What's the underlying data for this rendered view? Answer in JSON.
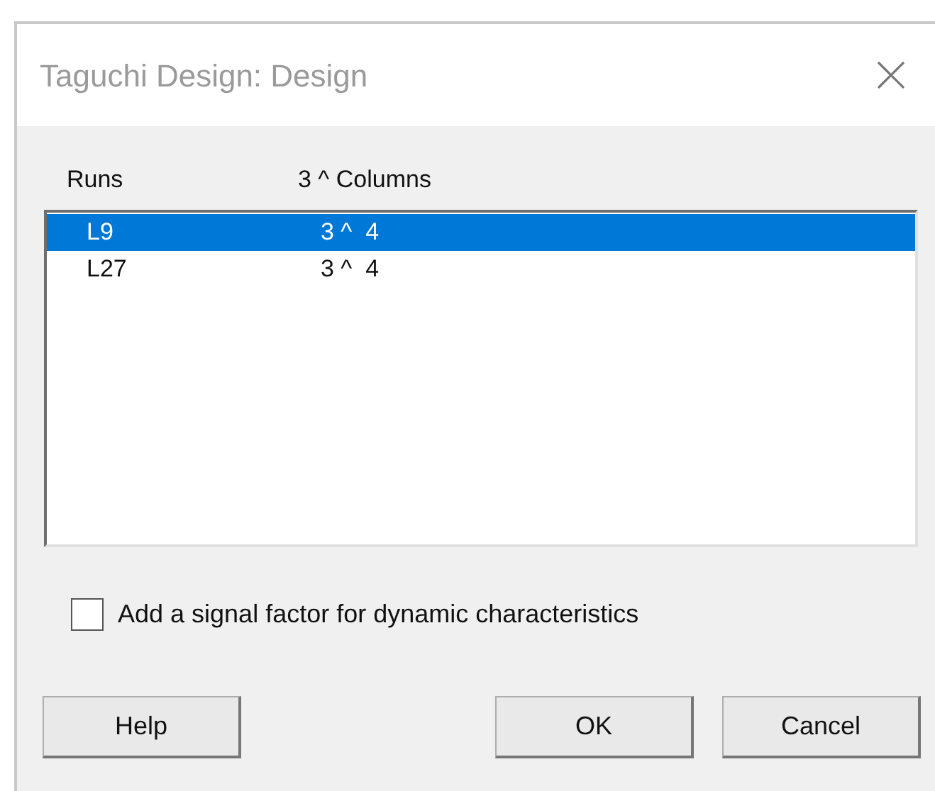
{
  "window": {
    "title": "Taguchi Design: Design"
  },
  "list": {
    "columns": [
      "Runs",
      "3 ^ Columns"
    ],
    "rows": [
      {
        "runs": "L9",
        "columns": "3 ^  4",
        "selected": true
      },
      {
        "runs": "L27",
        "columns": "3 ^  4",
        "selected": false
      }
    ]
  },
  "checkbox": {
    "label": "Add a signal factor for dynamic characteristics",
    "checked": false
  },
  "buttons": [
    {
      "label": "Help"
    },
    {
      "label": "OK"
    },
    {
      "label": "Cancel"
    }
  ]
}
